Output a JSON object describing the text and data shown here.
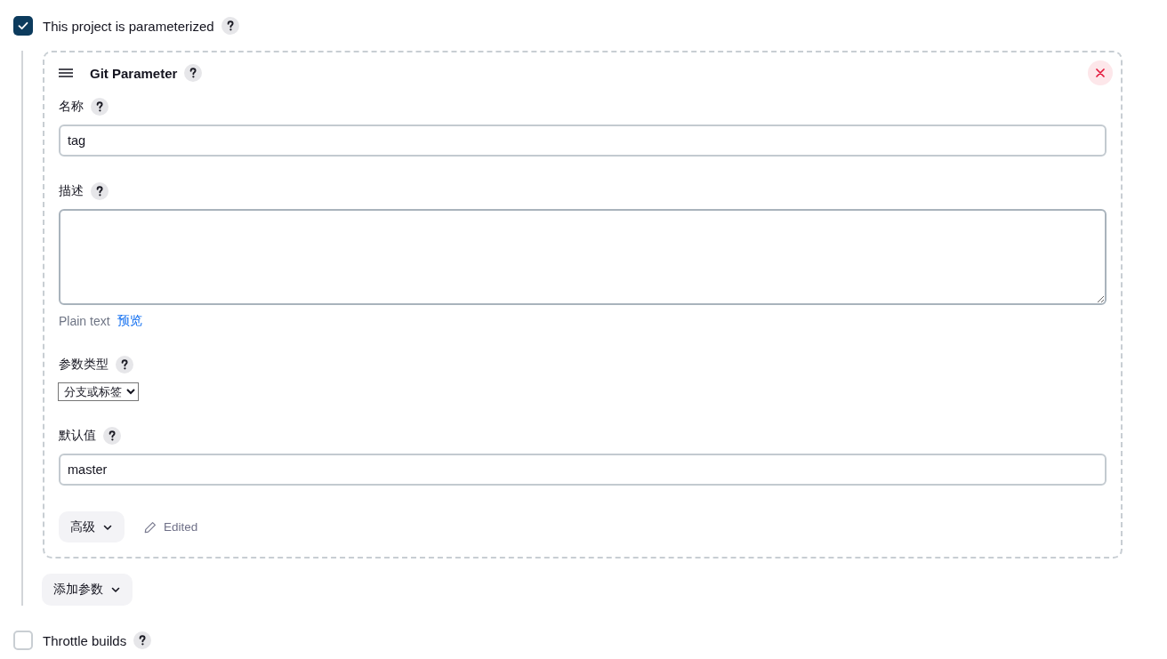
{
  "parameterized": {
    "label": "This project is parameterized",
    "checked": true
  },
  "parameters": [
    {
      "title": "Git Parameter",
      "fields": [
        {
          "kind": "text",
          "label": "名称",
          "value": "tag"
        },
        {
          "kind": "textarea",
          "label": "描述",
          "note": "Plain text",
          "link": "预览"
        },
        {
          "kind": "select",
          "label": "参数类型",
          "value": "分支或标签"
        },
        {
          "kind": "text",
          "label": "默认值",
          "value": "master"
        }
      ],
      "advanced_button": "高级",
      "edited_label": "Edited"
    }
  ],
  "add_button": "添加参数",
  "throttle": {
    "label": "Throttle builds",
    "checked": false
  }
}
